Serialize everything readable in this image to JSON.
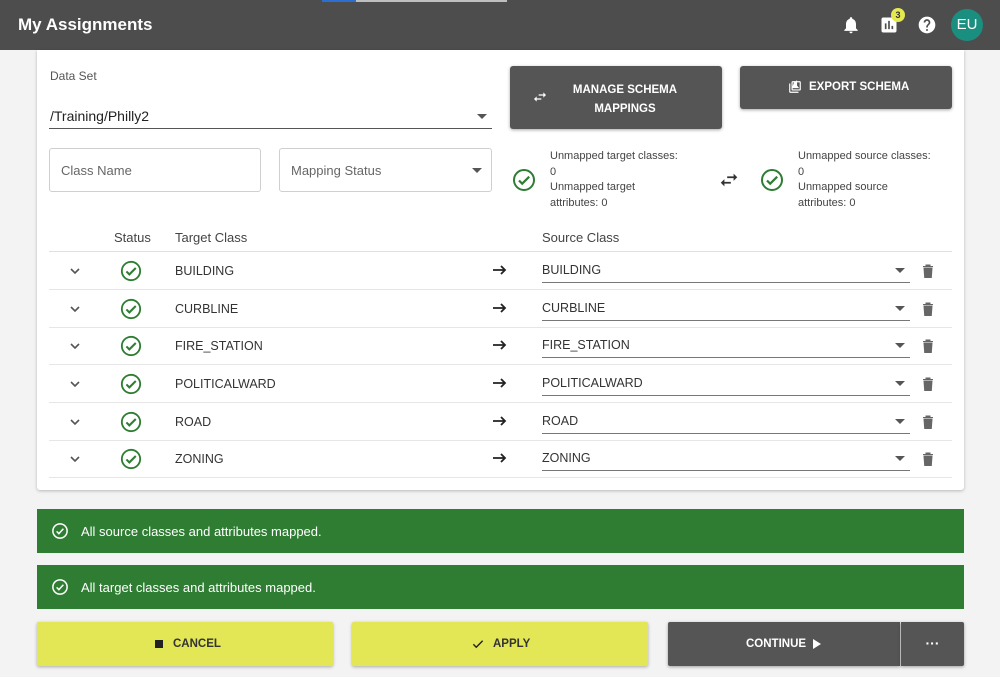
{
  "app": {
    "title": "My Assignments",
    "notification_count": "3",
    "avatar_initials": "EU"
  },
  "icons": {
    "bell": "bell-icon",
    "chart": "bar-chart-icon",
    "help": "help-icon",
    "check": "check-circle-icon",
    "swap": "swap-icon",
    "trash": "trash-icon"
  },
  "colors": {
    "topbar": "#4d4d4d",
    "accent_yellow": "#e3e655",
    "success_green": "#2e7d32",
    "avatar": "#1b8f7f"
  },
  "dataset": {
    "label": "Data Set",
    "value": "/Training/Philly2"
  },
  "filters": {
    "class_name_placeholder": "Class Name",
    "mapping_status_placeholder": "Mapping Status"
  },
  "buttons": {
    "manage_line1": "MANAGE SCHEMA",
    "manage_line2": "MAPPINGS",
    "export": "EXPORT SCHEMA",
    "cancel": "CANCEL",
    "apply": "APPLY",
    "continue": "CONTINUE",
    "more": "···"
  },
  "summary": {
    "target_classes_label": "Unmapped target classes:",
    "target_classes_value": "0",
    "target_attrs_label1": "Unmapped target",
    "target_attrs_label2": "attributes: 0",
    "source_classes_label": "Unmapped source classes:",
    "source_classes_value": "0",
    "source_attrs_label1": "Unmapped source",
    "source_attrs_label2": "attributes: 0"
  },
  "table": {
    "headers": {
      "status": "Status",
      "target": "Target Class",
      "source": "Source Class"
    },
    "rows": [
      {
        "target": "BUILDING",
        "source": "BUILDING"
      },
      {
        "target": "CURBLINE",
        "source": "CURBLINE"
      },
      {
        "target": "FIRE_STATION",
        "source": "FIRE_STATION"
      },
      {
        "target": "POLITICALWARD",
        "source": "POLITICALWARD"
      },
      {
        "target": "ROAD",
        "source": "ROAD"
      },
      {
        "target": "ZONING",
        "source": "ZONING"
      }
    ]
  },
  "banners": {
    "source": "All source classes and attributes mapped.",
    "target": "All target classes and attributes mapped."
  }
}
